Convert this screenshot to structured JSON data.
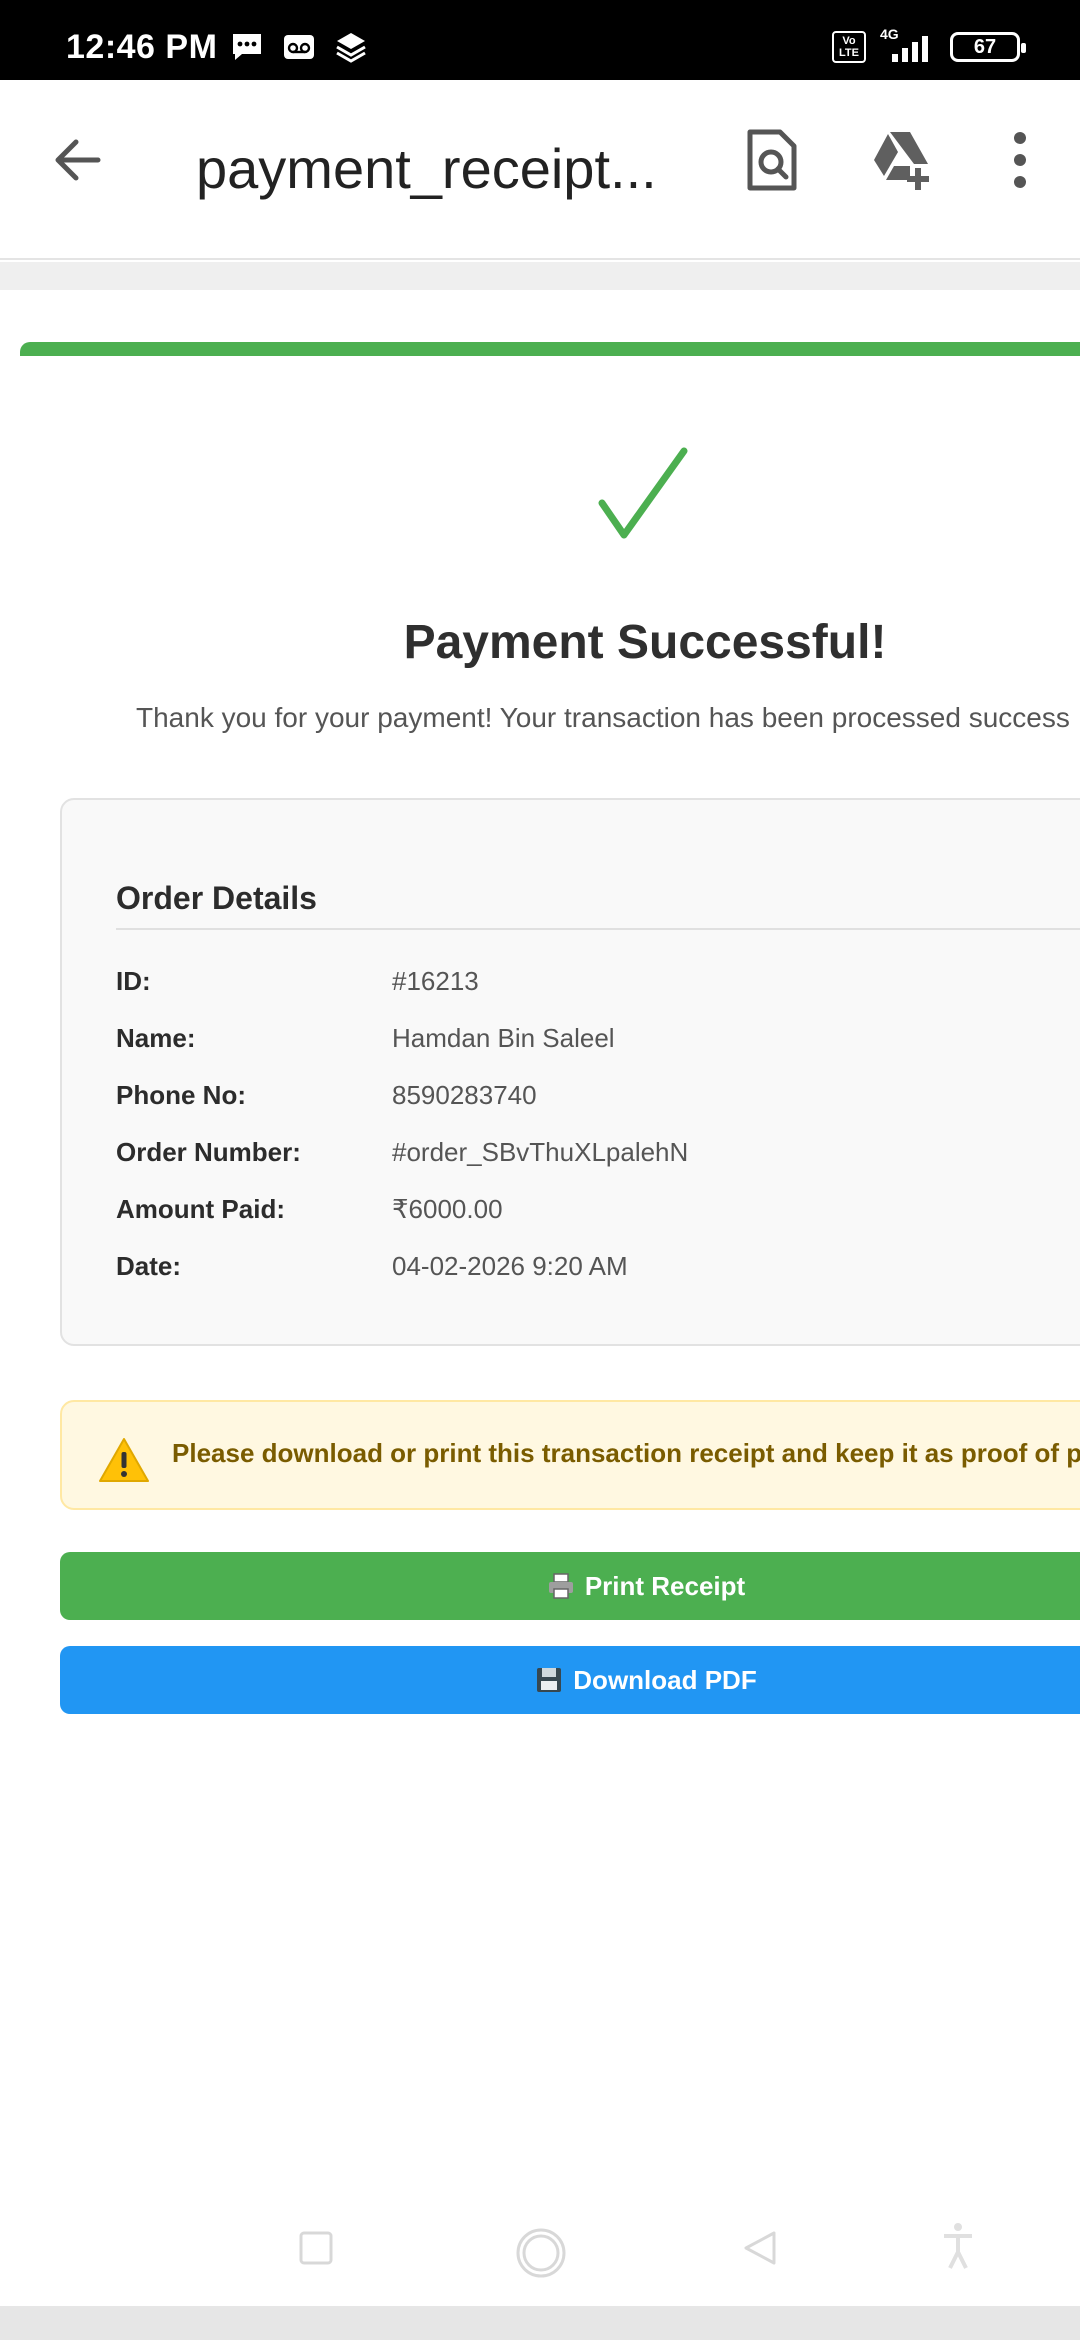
{
  "status_bar": {
    "time": "12:46 PM",
    "network": "4G",
    "volte": "Vo LTE",
    "battery": "67"
  },
  "app_bar": {
    "title": "payment_receipt...",
    "icons": [
      "back-arrow-icon",
      "search-in-document-icon",
      "add-to-drive-icon",
      "more-options-icon"
    ]
  },
  "receipt": {
    "success_title": "Payment Successful!",
    "thanks_message": "Thank you for your payment! Your transaction has been processed success",
    "order_details": {
      "heading": "Order Details",
      "rows": [
        {
          "key": "ID:",
          "value": "#16213"
        },
        {
          "key": "Name:",
          "value": "Hamdan Bin Saleel"
        },
        {
          "key": "Phone No:",
          "value": "8590283740"
        },
        {
          "key": "Order Number:",
          "value": "#order_SBvThuXLpalehN"
        },
        {
          "key": "Amount Paid:",
          "value": "₹6000.00"
        },
        {
          "key": "Date:",
          "value": "04-02-2026 9:20 AM"
        }
      ]
    },
    "warning": "Please download or print this transaction receipt and keep it as proof of pay",
    "print_button": "Print Receipt",
    "download_button": "Download PDF"
  },
  "colors": {
    "success_green": "#4caf50",
    "download_blue": "#2196f3",
    "warning_bg": "#fff8e1",
    "fab_pencil": "#3d7bd9"
  }
}
